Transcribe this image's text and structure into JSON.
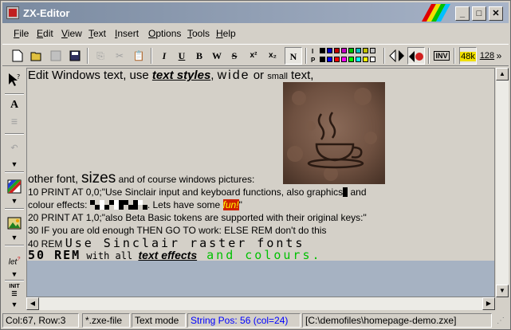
{
  "window": {
    "title": "ZX-Editor"
  },
  "menu": [
    "File",
    "Edit",
    "View",
    "Text",
    "Insert",
    "Options",
    "Tools",
    "Help"
  ],
  "menu_underline": [
    "F",
    "E",
    "V",
    "T",
    "I",
    "O",
    "T",
    "H"
  ],
  "toolbar": {
    "bold": "B",
    "italic": "I",
    "underline": "U",
    "wide": "W",
    "strike": "S",
    "superscript": "x²",
    "subscript": "x₂",
    "normal": "N",
    "palette_ink_label": "I",
    "palette_paper_label": "P",
    "ink_colors": [
      "#000000",
      "#0000c0",
      "#c00000",
      "#c000c0",
      "#00c000",
      "#00c0c0",
      "#c0c000",
      "#c0c0c0"
    ],
    "paper_colors": [
      "#000000",
      "#0000ff",
      "#ff0000",
      "#ff00ff",
      "#00ff00",
      "#00ffff",
      "#ffff00",
      "#ffffff"
    ],
    "inv_label": "INV",
    "mode_48k": "48k",
    "mode_128": "128",
    "more": "»"
  },
  "lefttool": {
    "text_label": "A",
    "let_label": "let",
    "init_label": "INIT"
  },
  "editor": {
    "line1_a": "Edit Windows text, use ",
    "line1_b": "text styles",
    "line1_c": ", ",
    "line1_d": "wide",
    "line1_e": " or ",
    "line1_f": "small",
    "line1_g": " text,",
    "line2_a": "other font, ",
    "line2_b": "sizes",
    "line2_c": " and of course windows pictures:",
    "line3": "10 PRINT AT 0,0;\"Use Sinclair input and keyboard functions, also graphics",
    "line3_end": " and",
    "line4_a": "colour effects: ",
    "line4_b": ". Lets have some ",
    "line4_fun": "fun!",
    "line4_c": "\"",
    "line5": "20 PRINT AT 1,0;\"also Beta Basic tokens are supported with their original keys:\"",
    "line6": "30 IF you are old enough THEN GO TO work: ELSE REM don't do this",
    "line7_a": "40 REM ",
    "line7_b": "Use Sinclair raster fonts",
    "line8_a": "50 REM",
    "line8_b": " with all ",
    "line8_c": "text effects",
    "line8_d": " and colours."
  },
  "status": {
    "pos": "Col:67, Row:3",
    "filetype": "*.zxe-file",
    "mode": "Text mode",
    "string_pos": "String Pos: 56 (col=24)",
    "path": "[C:\\demofiles\\homepage-demo.zxe]"
  },
  "colors": {
    "accent_blue": "#0000ff",
    "green_text": "#00c000",
    "fun_bg": "#d02000",
    "fun_fg": "#ffff00"
  }
}
